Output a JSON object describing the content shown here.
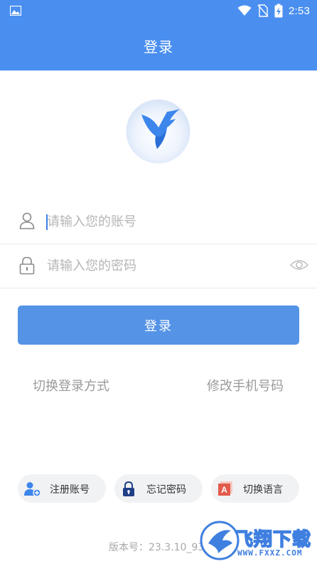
{
  "status_bar": {
    "time": "2:53"
  },
  "app_bar": {
    "title": "登录"
  },
  "form": {
    "account_placeholder": "请输入您的账号",
    "password_placeholder": "请输入您的密码",
    "login_label": "登录"
  },
  "links": {
    "switch_login_mode": "切换登录方式",
    "change_phone": "修改手机号码"
  },
  "actions": {
    "register": "注册账号",
    "forgot_password": "忘记密码",
    "switch_language": "切换语言"
  },
  "version_text": "版本号：23.3.10_93",
  "watermark": {
    "text": "飞翔下载",
    "url": "WWW.FXXZ.COM"
  },
  "colors": {
    "primary": "#4a8ff0",
    "button": "#5493e6",
    "placeholder": "#b5b5b5",
    "pill_bg": "#f1f2f4"
  }
}
